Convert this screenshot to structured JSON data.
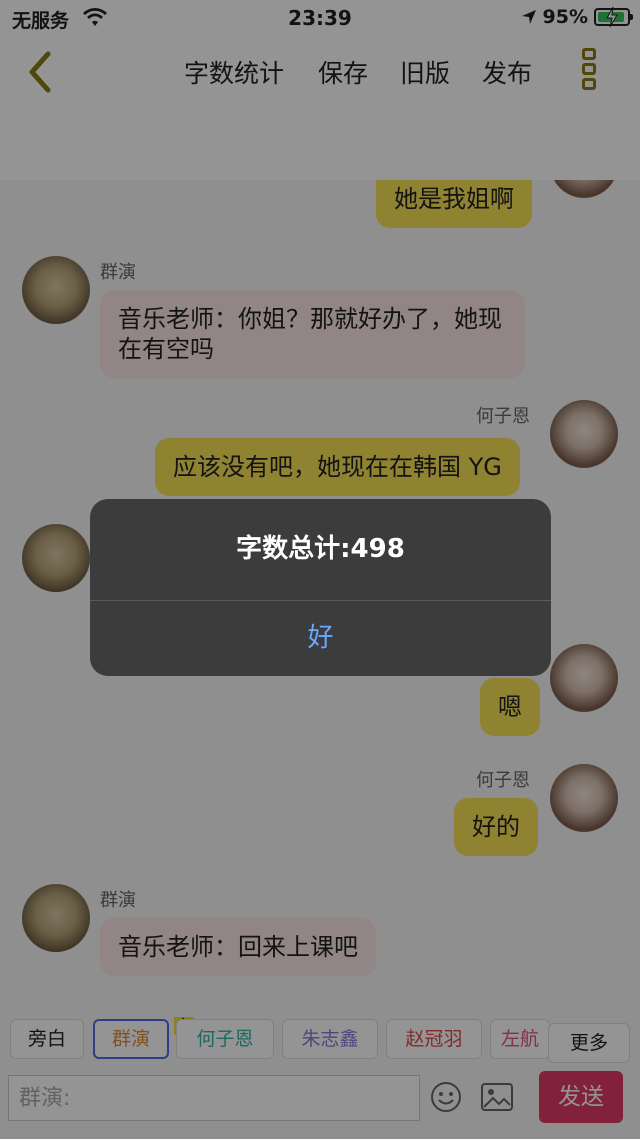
{
  "status_bar": {
    "carrier": "无服务",
    "time": "23:39",
    "battery": "95%",
    "battery_level": 0.95
  },
  "navbar": {
    "back_icon": "chevron-left-icon",
    "word_count": "字数统计",
    "save": "保存",
    "old_version": "旧版",
    "publish": "发布",
    "more_icon": "more-icon"
  },
  "messages": [
    {
      "side": "right",
      "sender": "",
      "text": "她是我姐啊",
      "avatar": "girl"
    },
    {
      "side": "left",
      "sender": "群演",
      "text": "音乐老师：你姐？那就好办了，她现在有空吗",
      "avatar": "doll"
    },
    {
      "side": "right",
      "sender": "何子恩",
      "text": "应该没有吧，她现在在韩国 YG",
      "avatar": "girl"
    },
    {
      "side": "left",
      "sender": "",
      "text": "",
      "avatar": "doll"
    },
    {
      "side": "right",
      "sender": "",
      "text": "嗯",
      "avatar": "girl"
    },
    {
      "side": "right",
      "sender": "何子恩",
      "text": "好的",
      "avatar": "girl"
    },
    {
      "side": "left",
      "sender": "群演",
      "text": "音乐老师：回来上课吧",
      "avatar": "doll"
    }
  ],
  "roles": {
    "narration": "旁白",
    "extras": "群演",
    "main_badge": "主",
    "he_zien": "何子恩",
    "zhu_zhixin": "朱志鑫",
    "zhao_guanyu": "赵冠羽",
    "zuo_hang": "左航",
    "more": "更多"
  },
  "role_colors": {
    "extras": "#e08a3a",
    "he_zien": "#2fb5a8",
    "zhu_zhixin": "#8a78d6",
    "zhao_guanyu": "#e24a4a",
    "zuo_hang": "#e0557a"
  },
  "input": {
    "placeholder": "群演:",
    "emoji_icon": "emoji-icon",
    "image_icon": "image-icon",
    "send": "发送"
  },
  "dialog": {
    "title": "字数总计:498",
    "ok": "好"
  },
  "colors": {
    "accent_yellow": "#f6e055",
    "send_button": "#e03a64",
    "dialog_ok": "#6aa7ff"
  }
}
